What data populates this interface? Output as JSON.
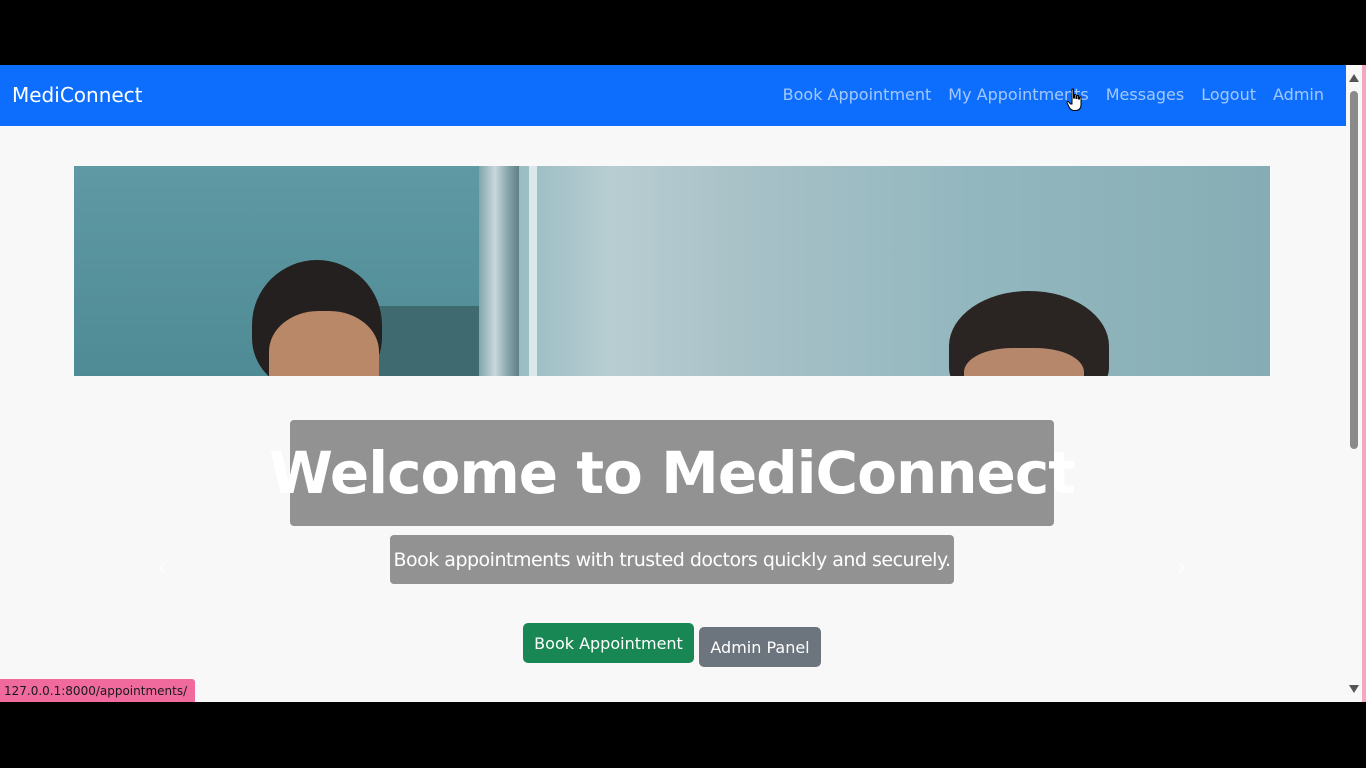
{
  "navbar": {
    "brand": "MediConnect",
    "links": [
      "Book Appointment",
      "My Appointments",
      "Messages",
      "Logout",
      "Admin"
    ]
  },
  "hero": {
    "title": "Welcome to MediConnect",
    "subtitle": "Book appointments with trusted doctors quickly and securely."
  },
  "buttons": {
    "book": "Book Appointment",
    "admin": "Admin Panel"
  },
  "carousel": {
    "prev_icon": "chevron-left-icon",
    "next_icon": "chevron-right-icon"
  },
  "status_bar": {
    "url": "127.0.0.1:8000/appointments/"
  },
  "colors": {
    "navbar": "#0d6efd",
    "book_button": "#198754",
    "admin_button": "#6c757d",
    "status_bar": "#f06a9e"
  }
}
